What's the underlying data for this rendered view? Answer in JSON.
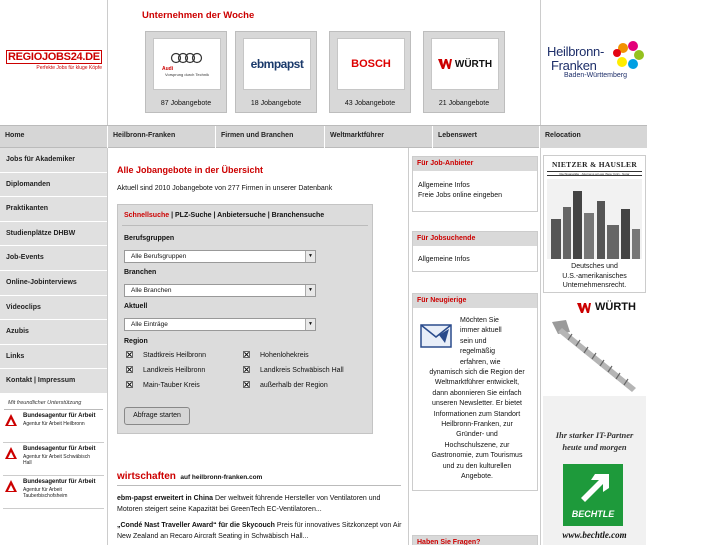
{
  "site": {
    "logo_text": "REGIOJOBS24.DE",
    "logo_tagline": "Perfekte Jobs für kluge Köpfe"
  },
  "unternehmen": {
    "title": "Unternehmen der Woche",
    "cards": [
      {
        "name": "Audi",
        "logo_text": "Audi",
        "logo_sub": "Vorsprung durch Technik",
        "count": "87 Jobangebote"
      },
      {
        "name": "ebm-papst",
        "logo_text": "ebmpapst",
        "logo_sub": "",
        "count": "18 Jobangebote"
      },
      {
        "name": "Bosch",
        "logo_text": "BOSCH",
        "logo_sub": "",
        "count": "43 Jobangebote"
      },
      {
        "name": "Würth",
        "logo_text": "WÜRTH",
        "logo_sub": "",
        "count": "21 Jobangebote"
      }
    ]
  },
  "region_logo": {
    "line1": "Heilbronn-",
    "line2": "Franken",
    "line3": "Baden-Württemberg"
  },
  "nav": [
    "Home",
    "Heilbronn-Franken",
    "Firmen und Branchen",
    "Weltmarktführer",
    "Lebenswert",
    "Relocation"
  ],
  "sidebar": {
    "items": [
      "Jobs für Akademiker",
      "Diplomanden",
      "Praktikanten",
      "Studienplätze DHBW",
      "Job-Events",
      "Online-Jobinterviews",
      "Videoclips",
      "Azubis",
      "Links",
      "Kontakt | Impressum"
    ],
    "support_text": "Mit freundlicher Unterstützung",
    "agencies": [
      {
        "title": "Bundesagentur für Arbeit",
        "sub": "Agentur für Arbeit Heilbronn"
      },
      {
        "title": "Bundesagentur für Arbeit",
        "sub": "Agentur für Arbeit Schwäbisch Hall"
      },
      {
        "title": "Bundesagentur für Arbeit",
        "sub": "Agentur für Arbeit Tauberbischofsheim"
      }
    ]
  },
  "main": {
    "title": "Alle Jobangebote in der Übersicht",
    "count_text": "Aktuell sind 2010 Jobangebote von 277 Firmen in unserer Datenbank",
    "search": {
      "tabs": [
        "Schnellsuche",
        "PLZ-Suche",
        "Anbietersuche",
        "Branchensuche"
      ],
      "berufsgruppen_label": "Berufsgruppen",
      "berufsgruppen_value": "Alle Berufsgruppen",
      "branchen_label": "Branchen",
      "branchen_value": "Alle Branchen",
      "aktuell_label": "Aktuell",
      "aktuell_value": "Alle Einträge",
      "region_label": "Region",
      "regions": [
        "Stadtkreis Heilbronn",
        "Hohenlohekreis",
        "Landkreis Heilbronn",
        "Landkreis Schwäbisch Hall",
        "Main-Tauber Kreis",
        "außerhalb der Region"
      ],
      "button": "Abfrage starten"
    },
    "wirtschaften_big": "wirtschaften",
    "wirtschaften_small": "auf heilbronn-franken.com",
    "news": [
      {
        "headline": "ebm-papst erweitert in China",
        "text": "Der weltweit führende Hersteller von Ventilatoren und Motoren steigert seine Kapazität bei GreenTech EC-Ventilatoren..."
      },
      {
        "headline": "„Condé Nast Traveller Award“ für die Skycouch",
        "text": "Preis für innovatives Sitzkonzept von Air New Zealand an Recaro Aircraft Seating in Schwäbisch Hall..."
      }
    ]
  },
  "info_boxes": {
    "anbieter": {
      "title": "Für Job-Anbieter",
      "line1": "Allgemeine Infos",
      "line2": "Freie Jobs online eingeben"
    },
    "jobsuchende": {
      "title": "Für Jobsuchende",
      "line1": "Allgemeine Infos"
    },
    "neugierige": {
      "title": "Für Neugierige",
      "text_right": [
        "Möchten Sie",
        "immer aktuell",
        "sein und",
        "regelmäßig",
        "erfahren, wie"
      ],
      "text_full": [
        "dynamisch sich die Region der",
        "Weltmarktführer entwickelt,",
        "dann abonnieren Sie einfach",
        "unseren Newsletter. Er bietet",
        "Informationen zum Standort",
        "Heilbronn-Franken, zur",
        "Gründer- und",
        "Hochschulszene, zur",
        "Gastronomie, zum Tourismus",
        "und zu den kulturellen",
        "Angebote."
      ]
    },
    "fragen": {
      "title": "Haben Sie Fragen?"
    }
  },
  "ads": {
    "nietzer": {
      "name": "NIETZER & HAUSLER",
      "tagline": "Rechtsanwälte · Attorneys at Law (New York) · Notar",
      "caption": [
        "Deutsches und",
        "U.S.-amerikanisches",
        "Unternehmensrecht."
      ]
    },
    "wuerth": {
      "name": "WÜRTH"
    },
    "bechtle": {
      "line1": "Ihr starker IT-Partner",
      "line2": "heute und morgen",
      "brand": "BECHTLE",
      "url": "www.bechtle.com"
    }
  },
  "colors": {
    "accent_red": "#cc0000",
    "nav_gray": "#d6d6d6",
    "panel_gray": "#dcdcdc"
  }
}
